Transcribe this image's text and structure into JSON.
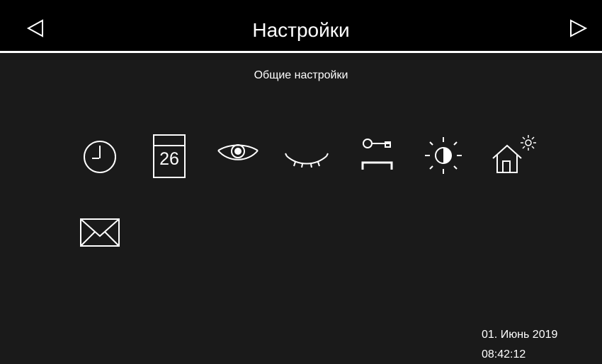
{
  "header": {
    "title": "Настройки",
    "nav_left_icon": "triangle-left-icon",
    "nav_right_icon": "triangle-right-icon"
  },
  "section": {
    "subtitle": "Общие настройки"
  },
  "settings_icons": [
    {
      "name": "clock-icon"
    },
    {
      "name": "calendar-icon",
      "day": "26"
    },
    {
      "name": "eye-open-icon"
    },
    {
      "name": "eye-closed-icon"
    },
    {
      "name": "key-icon"
    },
    {
      "name": "brightness-icon"
    },
    {
      "name": "home-sun-icon"
    },
    {
      "name": "mail-icon"
    }
  ],
  "footer": {
    "date": "01. Июнь 2019",
    "time": "08:42:12"
  },
  "colors": {
    "background": "#1a1a1a",
    "header": "#000000",
    "foreground": "#ffffff"
  }
}
